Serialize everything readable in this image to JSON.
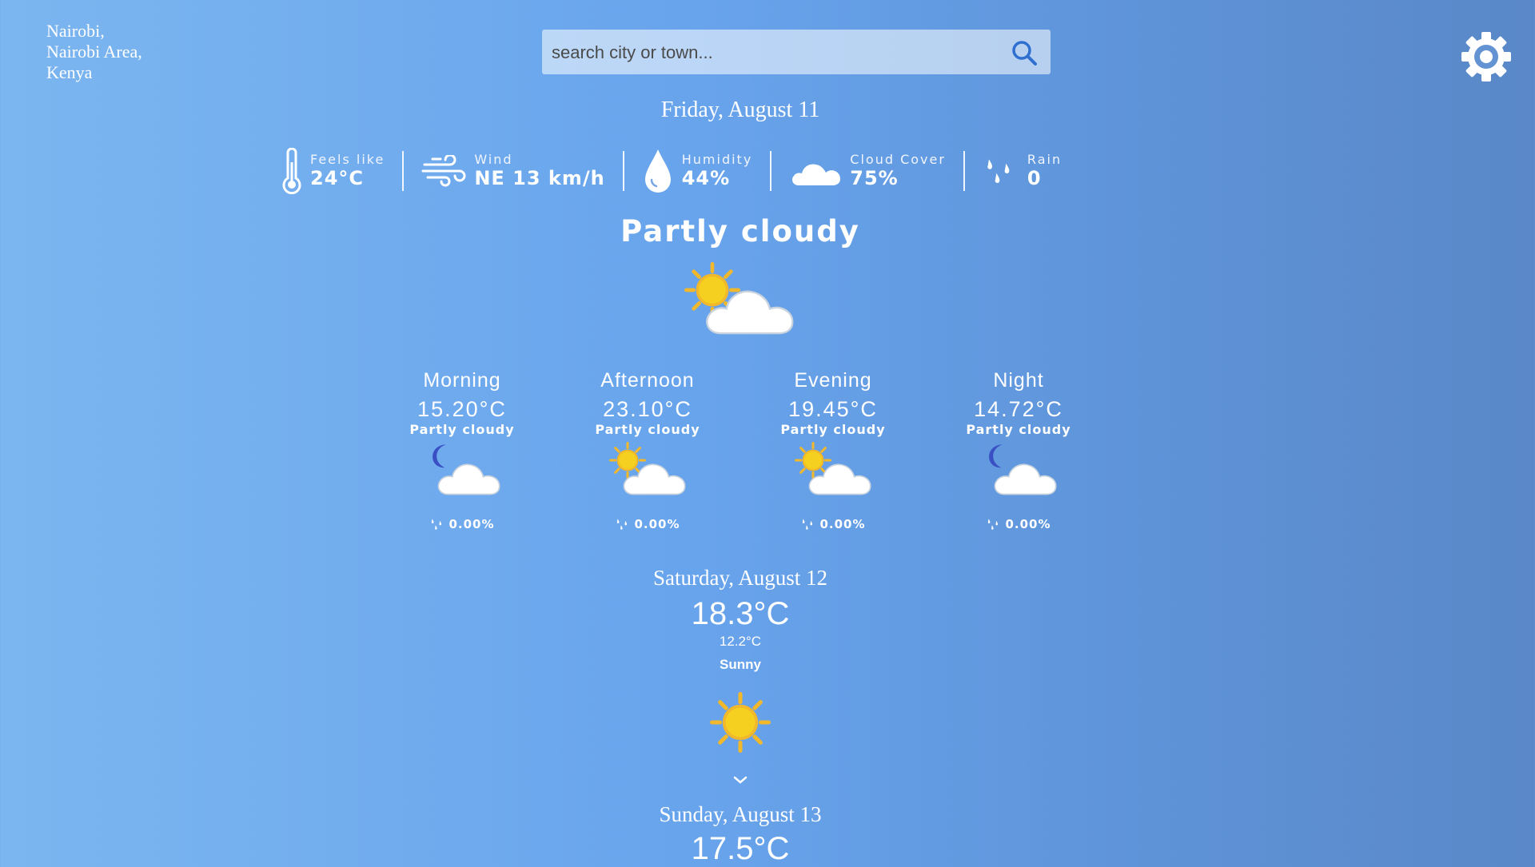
{
  "location": {
    "line1": "Nairobi,",
    "line2": "Nairobi Area,",
    "line3": "Kenya"
  },
  "search": {
    "placeholder": "search city or town..."
  },
  "today": {
    "date": "Friday, August 11",
    "stats": {
      "feels_like": {
        "label": "Feels like",
        "value": "24°C",
        "icon": "thermometer-icon"
      },
      "wind": {
        "label": "Wind",
        "value": "NE 13 km/h",
        "icon": "wind-icon"
      },
      "humidity": {
        "label": "Humidity",
        "value": "44%",
        "icon": "water-drop-icon"
      },
      "cloud_cover": {
        "label": "Cloud Cover",
        "value": "75%",
        "icon": "cloud-icon"
      },
      "rain": {
        "label": "Rain",
        "value": "0",
        "icon": "rain-drops-icon"
      }
    },
    "condition": "Partly cloudy",
    "periods": [
      {
        "name": "Morning",
        "temp": "15.20°C",
        "condition": "Partly cloudy",
        "rain": "0.00%",
        "icon": "moon-cloud-icon"
      },
      {
        "name": "Afternoon",
        "temp": "23.10°C",
        "condition": "Partly cloudy",
        "rain": "0.00%",
        "icon": "sun-cloud-icon"
      },
      {
        "name": "Evening",
        "temp": "19.45°C",
        "condition": "Partly cloudy",
        "rain": "0.00%",
        "icon": "sun-cloud-icon"
      },
      {
        "name": "Night",
        "temp": "14.72°C",
        "condition": "Partly cloudy",
        "rain": "0.00%",
        "icon": "moon-cloud-icon"
      }
    ]
  },
  "forecast": [
    {
      "date": "Saturday, August 12",
      "high": "18.3°C",
      "low": "12.2°C",
      "condition": "Sunny"
    },
    {
      "date": "Sunday, August 13",
      "high": "17.5°C"
    }
  ],
  "colors": {
    "sun": "#f5d020",
    "sun_ray": "#f2b82c",
    "moon": "#3b4fc4",
    "cloud": "#ffffff"
  }
}
